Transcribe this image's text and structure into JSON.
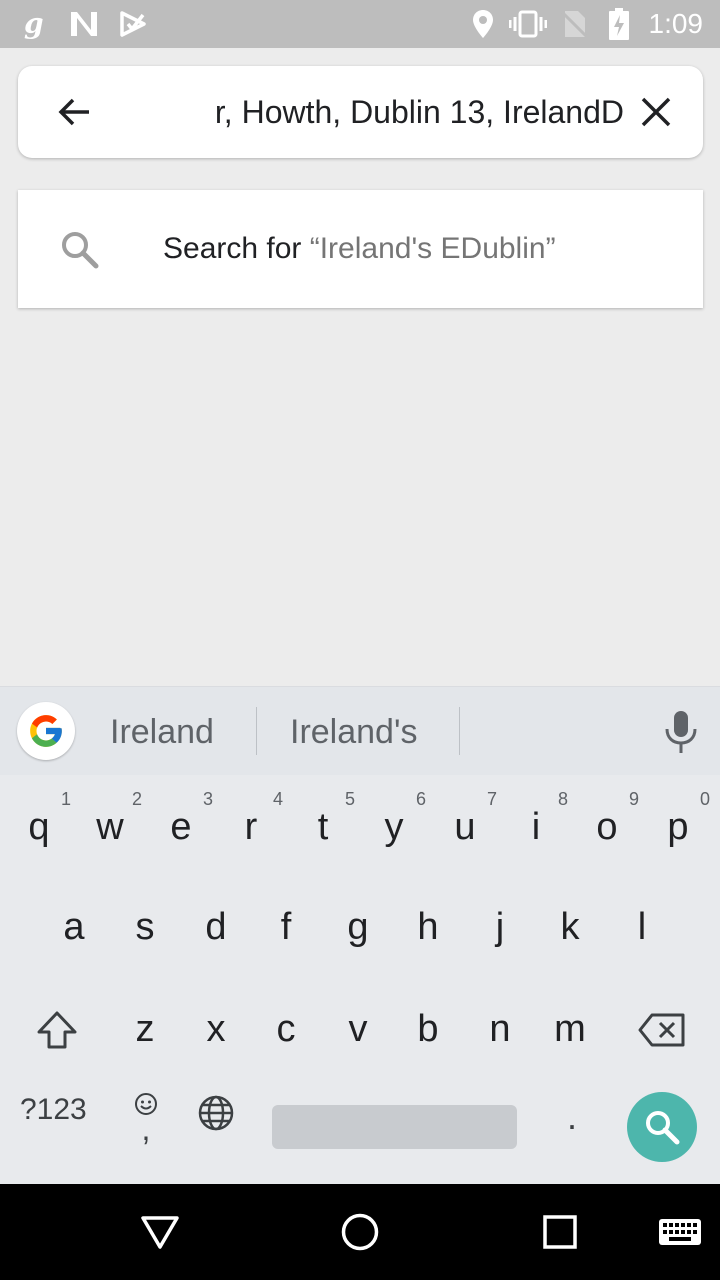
{
  "status_bar": {
    "time": "1:09",
    "icons": [
      "g-notification-icon",
      "n-notification-icon",
      "play-store-icon",
      "location-icon",
      "vibrate-icon",
      "no-sim-icon",
      "battery-charging-icon"
    ],
    "background": "#bdbdbd"
  },
  "search_box": {
    "value": "r, Howth, Dublin 13, IrelandD",
    "back_icon": "arrow-back-icon",
    "clear_icon": "close-icon"
  },
  "suggestion": {
    "prefix": "Search for ",
    "query": "“Ireland's EDublin”",
    "icon": "search-icon"
  },
  "keyboard": {
    "suggestions": [
      "Ireland",
      "Ireland's"
    ],
    "row1": [
      {
        "letter": "q",
        "hint": "1"
      },
      {
        "letter": "w",
        "hint": "2"
      },
      {
        "letter": "e",
        "hint": "3"
      },
      {
        "letter": "r",
        "hint": "4"
      },
      {
        "letter": "t",
        "hint": "5"
      },
      {
        "letter": "y",
        "hint": "6"
      },
      {
        "letter": "u",
        "hint": "7"
      },
      {
        "letter": "i",
        "hint": "8"
      },
      {
        "letter": "o",
        "hint": "9"
      },
      {
        "letter": "p",
        "hint": "0"
      }
    ],
    "row2": [
      "a",
      "s",
      "d",
      "f",
      "g",
      "h",
      "j",
      "k",
      "l"
    ],
    "row3": [
      "z",
      "x",
      "c",
      "v",
      "b",
      "n",
      "m"
    ],
    "symbols_label": "?123",
    "comma_label": ",",
    "period_label": ".",
    "action_color": "#4db6ac"
  },
  "nav_bar": {
    "icons": [
      "back-triangle-icon",
      "home-circle-icon",
      "recents-square-icon",
      "keyboard-icon"
    ]
  }
}
